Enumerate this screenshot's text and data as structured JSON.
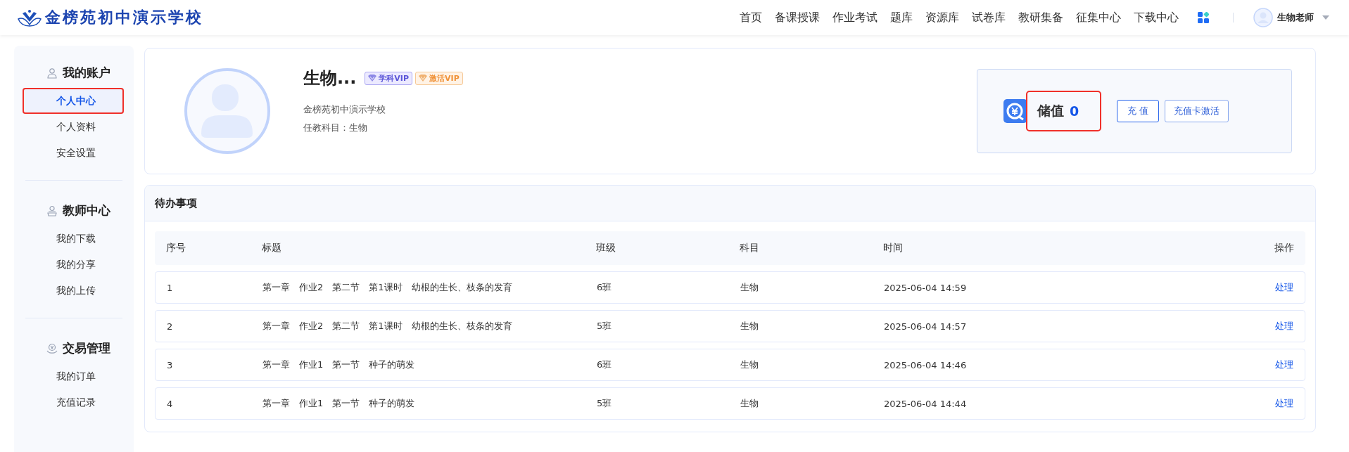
{
  "header": {
    "logo_text": "金榜苑初中演示学校",
    "nav": [
      "首页",
      "备课授课",
      "作业考试",
      "题库",
      "资源库",
      "试卷库",
      "教研集备",
      "征集中心",
      "下载中心"
    ],
    "user": {
      "name": "生物老师"
    }
  },
  "sidebar": {
    "sections": [
      {
        "title": "我的账户",
        "items": [
          {
            "label": "个人中心",
            "selected": true,
            "annotated": true
          },
          {
            "label": "个人资料",
            "selected": false,
            "annotated": false
          },
          {
            "label": "安全设置",
            "selected": false,
            "annotated": false
          }
        ]
      },
      {
        "title": "教师中心",
        "items": [
          {
            "label": "我的下载",
            "selected": false,
            "annotated": false
          },
          {
            "label": "我的分享",
            "selected": false,
            "annotated": false
          },
          {
            "label": "我的上传",
            "selected": false,
            "annotated": false
          }
        ]
      },
      {
        "title": "交易管理",
        "items": [
          {
            "label": "我的订单",
            "selected": false,
            "annotated": false
          },
          {
            "label": "充值记录",
            "selected": false,
            "annotated": false
          }
        ]
      }
    ]
  },
  "profile": {
    "name": "生物...",
    "badges": [
      {
        "label": "学科VIP",
        "kind": "subject"
      },
      {
        "label": "激活VIP",
        "kind": "activate"
      }
    ],
    "school": "金榜苑初中演示学校",
    "subject": "任教科目：生物"
  },
  "wallet": {
    "label": "储值",
    "value": "0",
    "annotated": true,
    "buttons": [
      "充 值",
      "充值卡激活"
    ]
  },
  "todo": {
    "title": "待办事项",
    "columns": [
      "序号",
      "标题",
      "班级",
      "科目",
      "时间",
      "操作"
    ],
    "rows": [
      {
        "cells": [
          "1",
          "第一章　作业2　第二节　第1课时　幼根的生长、枝条的发育",
          "6班",
          "生物",
          "2025-06-04 14:59"
        ],
        "action": "处理"
      },
      {
        "cells": [
          "2",
          "第一章　作业2　第二节　第1课时　幼根的生长、枝条的发育",
          "5班",
          "生物",
          "2025-06-04 14:57"
        ],
        "action": "处理"
      },
      {
        "cells": [
          "3",
          "第一章　作业1　第一节　种子的萌发",
          "6班",
          "生物",
          "2025-06-04 14:46"
        ],
        "action": "处理"
      },
      {
        "cells": [
          "4",
          "第一章　作业1　第一节　种子的萌发",
          "5班",
          "生物",
          "2025-06-04 14:44"
        ],
        "action": "处理"
      }
    ]
  }
}
